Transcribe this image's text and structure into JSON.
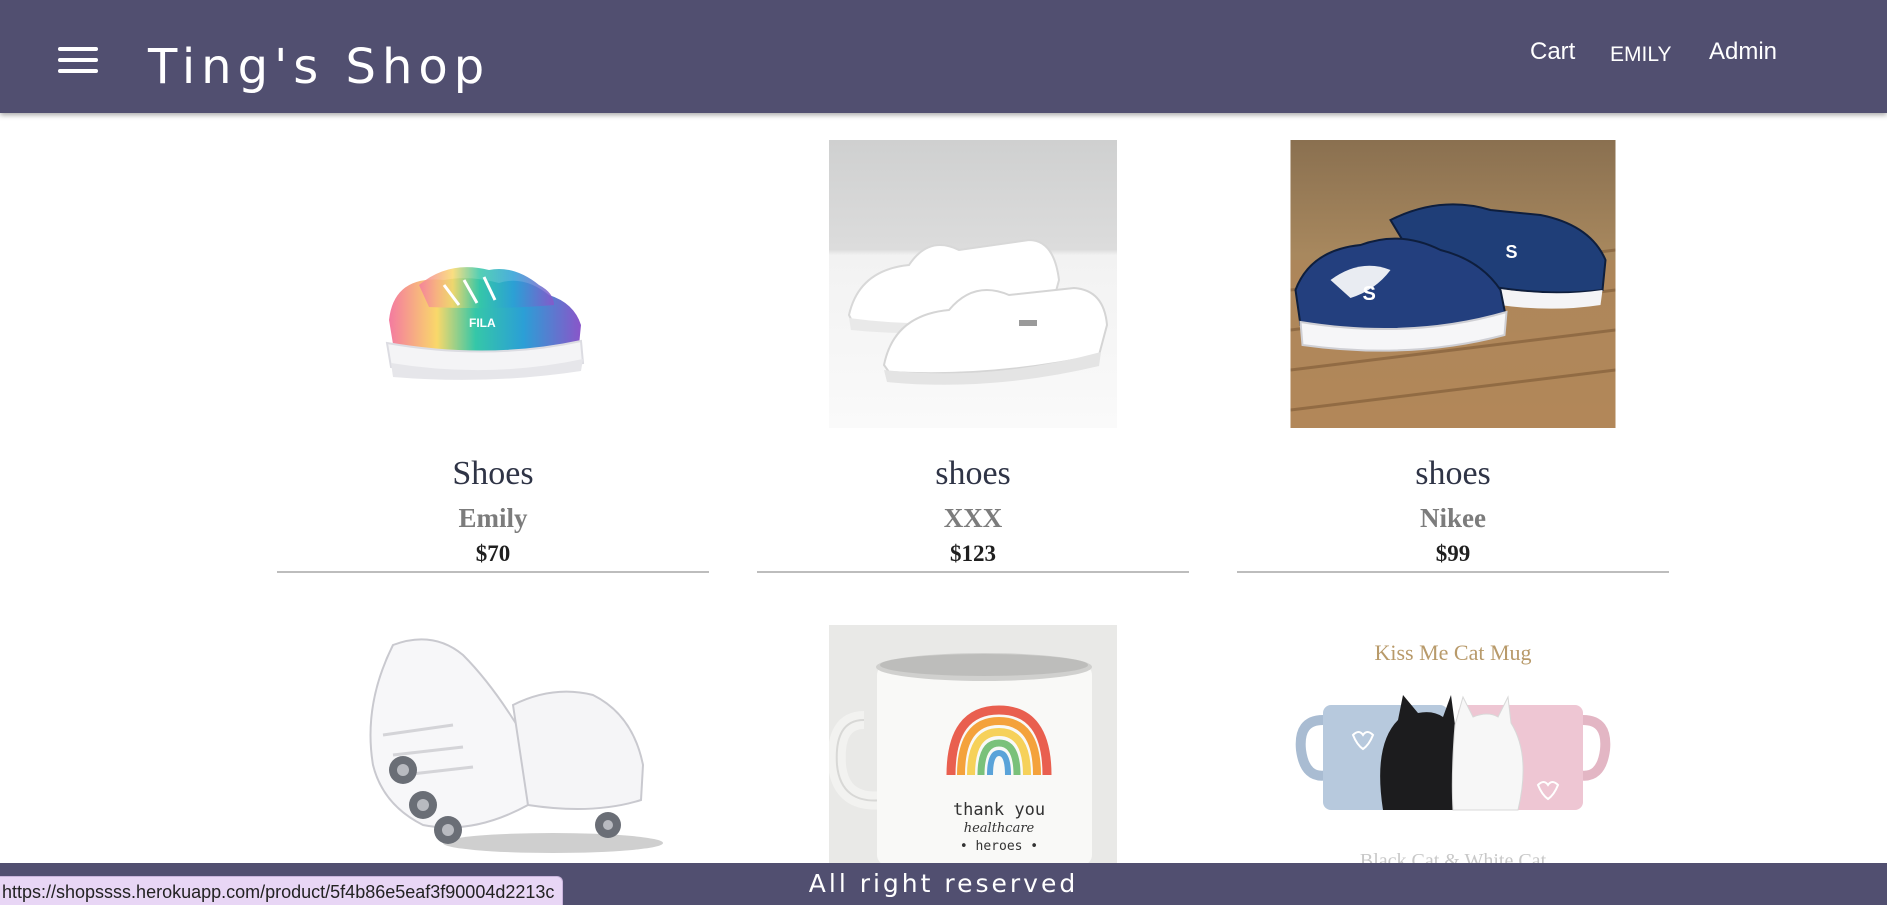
{
  "header": {
    "brand": "Ting's Shop",
    "nav": {
      "cart": "Cart",
      "user": "EMILY",
      "admin": "Admin"
    }
  },
  "products": [
    {
      "name": "Shoes",
      "brand": "Emily",
      "price": "$70",
      "image": "tie-dye-sneaker-image"
    },
    {
      "name": "shoes",
      "brand": "XXX",
      "price": "$123",
      "image": "white-slip-on-image"
    },
    {
      "name": "shoes",
      "brand": "Nikee",
      "price": "$99",
      "image": "navy-sneaker-image"
    },
    {
      "name": "",
      "brand": "",
      "price": "",
      "image": "roller-shoe-image"
    },
    {
      "name": "",
      "brand": "",
      "price": "",
      "image": "rainbow-mug-image",
      "mug_text": "thank you healthcare heroes"
    },
    {
      "name": "",
      "brand": "",
      "price": "",
      "image": "cat-mug-image",
      "caption": "Kiss Me Cat Mug",
      "subcaption": "Black Cat & White Cat"
    }
  ],
  "footer": {
    "text": "All right reserved"
  },
  "status_bar": {
    "url": "https://shopssss.herokuapp.com/product/5f4b86e5eaf3f90004d2213c"
  },
  "colors": {
    "header_bg": "#514f70",
    "footer_bg": "#514f70",
    "status_bg": "#e8d6f5"
  }
}
